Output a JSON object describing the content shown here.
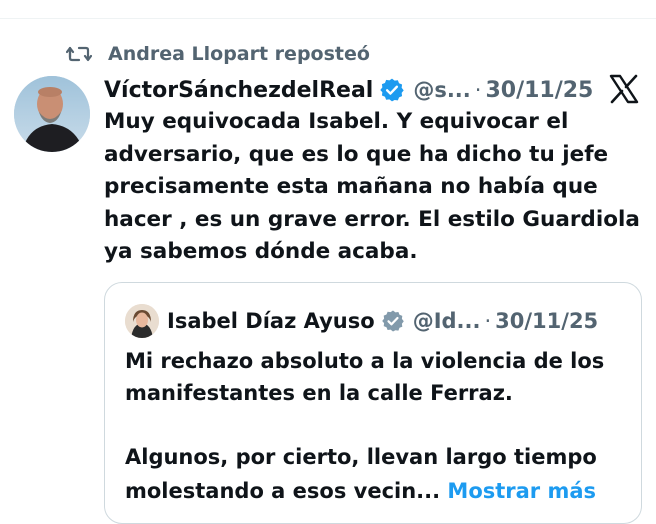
{
  "repost": {
    "label": "Andrea Llopart reposteó"
  },
  "tweet": {
    "author_name": "VíctorSánchezdelReal",
    "handle": "@s...",
    "separator": "·",
    "date": "30/11/25",
    "text": "Muy equivocada Isabel.  Y equivocar el\nadversario, que es lo que ha dicho tu jefe\nprecisamente esta mañana no había que\nhacer , es un grave error. El estilo Guardiola\nya sabemos dónde acaba."
  },
  "quote": {
    "author_name": "Isabel Díaz Ayuso",
    "handle": "@Id...",
    "separator": "·",
    "date": "30/11/25",
    "text": "Mi rechazo absoluto a la violencia de los\nmanifestantes en la calle Ferraz.\n\nAlgunos, por cierto, llevan largo tiempo",
    "text_tail": "molestando a esos vecin...",
    "show_more": "Mostrar más"
  },
  "colors": {
    "text": "#0f1419",
    "secondary": "#536471",
    "accent": "#1d9bf0",
    "verified_blue": "#1d9bf0",
    "verified_gray": "#829aab"
  },
  "icons": {
    "repost": "repost-icon",
    "verified": "verified-badge-icon",
    "verified_gray": "verified-gray-badge-icon",
    "logo": "x-logo-icon"
  }
}
